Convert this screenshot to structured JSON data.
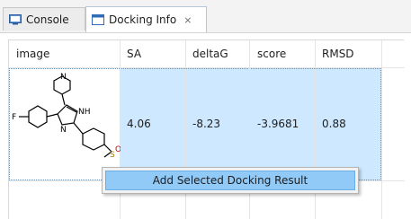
{
  "tabs": [
    {
      "label": "Console",
      "icon": "console-icon",
      "active": false
    },
    {
      "label": "Docking Info",
      "icon": "docking-info-icon",
      "active": true,
      "close_glyph": "⨯"
    }
  ],
  "table": {
    "columns": [
      "image",
      "SA",
      "deltaG",
      "score",
      "RMSD"
    ],
    "rows": [
      {
        "image": "molecule-structure",
        "SA": "4.06",
        "deltaG": "-8.23",
        "score": "-3.9681",
        "RMSD": "0.88"
      }
    ],
    "molecule_labels": {
      "fluorine": "F",
      "nh": "NH",
      "nitrogen1": "N",
      "nitrogen2": "N",
      "sulfur": "S",
      "oxygen": "O"
    }
  },
  "context_menu": {
    "items": [
      "Add Selected Docking Result"
    ]
  },
  "colors": {
    "selection": "#cde8ff",
    "menu_highlight": "#91c9f7"
  }
}
